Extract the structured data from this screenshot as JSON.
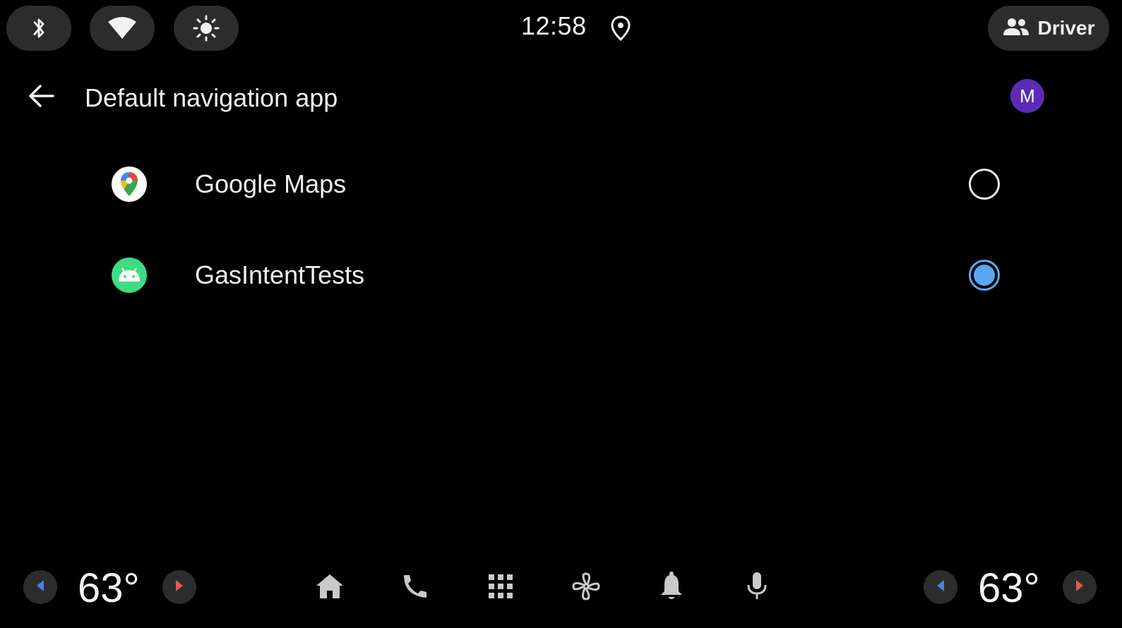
{
  "status_bar": {
    "time": "12:58",
    "user_chip": {
      "label": "Driver",
      "icon": "people-icon"
    },
    "quick_settings": [
      {
        "name": "bluetooth-icon"
      },
      {
        "name": "wifi-icon"
      },
      {
        "name": "brightness-icon"
      }
    ],
    "location_icon": "location-pin-icon"
  },
  "header": {
    "title": "Default navigation app",
    "back_icon": "back-arrow-icon",
    "avatar_initial": "M",
    "avatar_color": "#5b2bb5"
  },
  "apps": [
    {
      "label": "Google Maps",
      "icon": "google-maps-icon",
      "selected": false
    },
    {
      "label": "GasIntentTests",
      "icon": "android-icon",
      "selected": true
    }
  ],
  "bottom_bar": {
    "left_temp": "63°",
    "right_temp": "63°",
    "nav_icons": [
      "home-icon",
      "phone-icon",
      "app-grid-icon",
      "fan-icon",
      "bell-icon",
      "mic-icon"
    ]
  },
  "colors": {
    "background": "#000000",
    "chip": "#2c2c2c",
    "accent_radio": "#5aa8f5",
    "temp_down_arrow": "#4f7fd6",
    "temp_up_arrow": "#e05a4f"
  }
}
